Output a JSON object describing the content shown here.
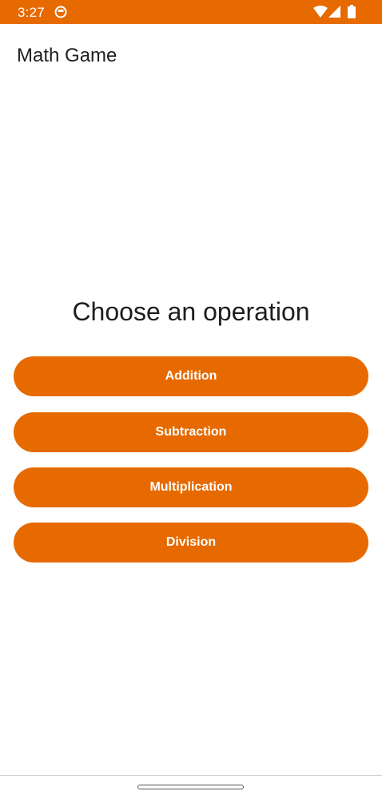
{
  "status_bar": {
    "time": "3:27",
    "color": "#e66a00",
    "icons": [
      "app-notification-icon",
      "wifi-icon",
      "signal-icon",
      "battery-icon"
    ]
  },
  "app": {
    "title": "Math Game"
  },
  "main": {
    "heading": "Choose an operation",
    "buttons": [
      {
        "label": "Addition"
      },
      {
        "label": "Subtraction"
      },
      {
        "label": "Multiplication"
      },
      {
        "label": "Division"
      }
    ],
    "accent_color": "#e66a00"
  }
}
